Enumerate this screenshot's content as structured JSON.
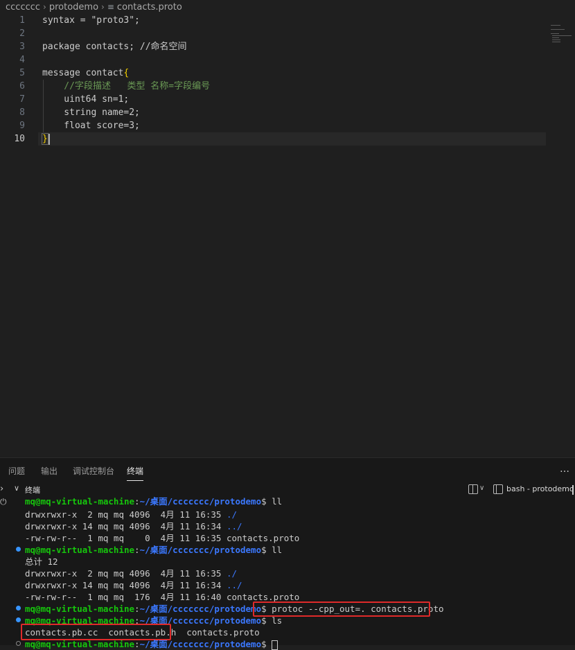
{
  "breadcrumb": {
    "items": [
      "ccccccc",
      "protodemo",
      "contacts.proto"
    ],
    "file_icon": "lines-file-icon"
  },
  "editor": {
    "lines": [
      {
        "n": "1",
        "text": "syntax = \"proto3\";"
      },
      {
        "n": "2",
        "text": ""
      },
      {
        "n": "3",
        "text": "package contacts; //命名空间"
      },
      {
        "n": "4",
        "text": ""
      },
      {
        "n": "5",
        "text": "message contact",
        "brace": "{"
      },
      {
        "n": "6",
        "text": "    //字段描述   类型 名称=字段编号"
      },
      {
        "n": "7",
        "text": "    uint64 sn=1;"
      },
      {
        "n": "8",
        "text": "    string name=2;"
      },
      {
        "n": "9",
        "text": "    float score=3;"
      },
      {
        "n": "10",
        "text": "",
        "brace": "}"
      }
    ],
    "active_line": "10"
  },
  "panel": {
    "tabs": [
      "问题",
      "输出",
      "调试控制台",
      "终端"
    ],
    "active_tab": "终端",
    "more_icon": "…"
  },
  "terminal": {
    "section_title": "终端",
    "instance_name": "bash - protodemo",
    "prompt_user": "mq@mq-virtual-machine",
    "prompt_colon": ":",
    "prompt_path": "~/桌面/ccccccc/protodemo",
    "prompt_dollar": "$ ",
    "lines": {
      "l1_cmd": "ll",
      "l2": "drwxrwxr-x  2 mq mq 4096  4月 11 16:35 ",
      "l2_dir": "./",
      "l3": "drwxrwxr-x 14 mq mq 4096  4月 11 16:34 ",
      "l3_dir": "../",
      "l4": "-rw-rw-r--  1 mq mq    0  4月 11 16:35 contacts.proto",
      "l5_cmd": "ll",
      "l6": "总计 12",
      "l7": "drwxrwxr-x  2 mq mq 4096  4月 11 16:35 ",
      "l7_dir": "./",
      "l8": "drwxrwxr-x 14 mq mq 4096  4月 11 16:34 ",
      "l8_dir": "../",
      "l9": "-rw-rw-r--  1 mq mq  176  4月 11 16:40 contacts.proto",
      "l10_cmd": "protoc --cpp_out=. contacts.proto",
      "l11_cmd": "ls",
      "l12_a": "contacts.pb.cc  contacts.pb.h",
      "l12_b": "  contacts.proto",
      "l13_cmd": ""
    }
  }
}
